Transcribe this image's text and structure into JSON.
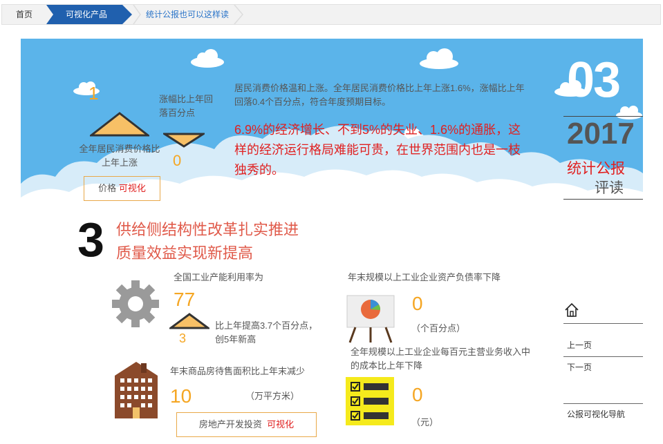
{
  "breadcrumb": {
    "home": "首页",
    "section": "可视化产品",
    "current": "统计公报也可以这样读"
  },
  "banner": {
    "price_up_value": "1",
    "price_up_label": "全年居民消费价格比上年上涨",
    "down_label": "涨幅比上年回落百分点",
    "down_value": "0",
    "price_link_text": "价格",
    "price_link_accent": "可视化",
    "summary": "居民消费价格温和上涨。全年居民消费价格比上年上涨1.6%，涨幅比上年回落0.4个百分点，符合年度预期目标。",
    "quote": "6.9%的经济增长、不到5%的失业、1.6%的通胀，这样的经济运行格局难能可贵，在世界范围内也是一枝独秀的。",
    "issue_number": "03",
    "year": "2017",
    "report_title": "统计公报",
    "report_subtitle": "评读"
  },
  "section": {
    "number": "3",
    "title_line1": "供给侧结构性改革扎实推进",
    "title_line2": "质量效益实现新提高"
  },
  "stats": {
    "capacity_label": "全国工业产能利用率为",
    "capacity_value": "77",
    "capacity_change_value": "3",
    "capacity_change_text": "比上年提高3.7个百分点，创5年新高",
    "housing_label": "年末商品房待售面积比上年末减少",
    "housing_value": "10",
    "housing_unit": "（万平方米）",
    "realestate_link": "房地产开发投资",
    "realestate_accent": "可视化",
    "debt_label": "年末规模以上工业企业资产负债率下降",
    "debt_value": "0",
    "debt_unit": "（个百分点）",
    "cost_label": "全年规模以上工业企业每百元主营业务收入中的成本比上年下降",
    "cost_value": "0",
    "cost_unit": "（元）"
  },
  "side": {
    "prev": "上一页",
    "next": "下一页",
    "nav": "公报可视化导航"
  },
  "colors": {
    "accent_blue": "#2060ae",
    "sky": "#5bb4ea",
    "orange": "#f5a623",
    "red": "#e02020"
  }
}
